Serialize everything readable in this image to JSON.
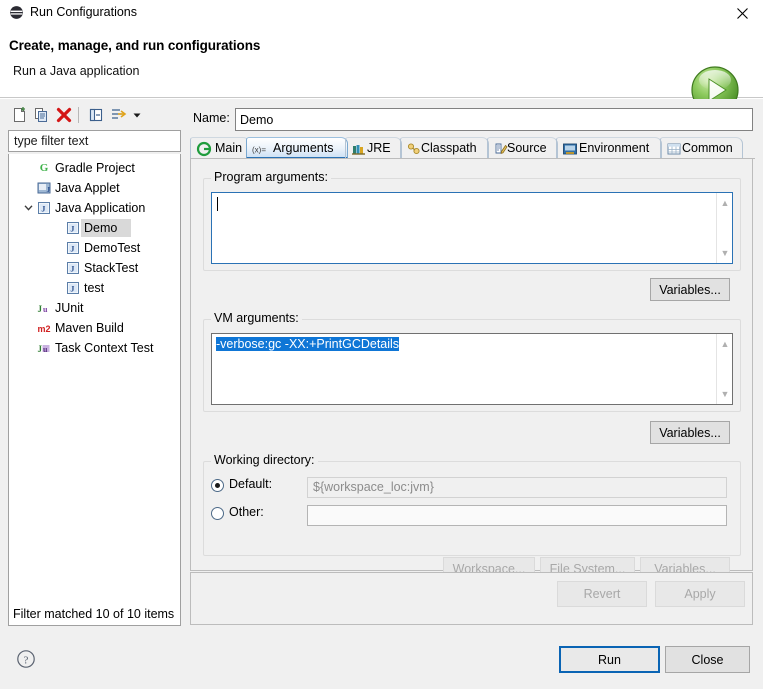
{
  "window": {
    "title": "Run Configurations",
    "icon": "eclipse-icon",
    "close_icon": "close-icon"
  },
  "header": {
    "title": "Create, manage, and run configurations",
    "subtitle": "Run a Java application",
    "badge_icon": "run-green-play-icon"
  },
  "sidebar": {
    "toolbar": [
      {
        "name": "new-configuration-button",
        "icon": "new-document-icon"
      },
      {
        "name": "duplicate-configuration-button",
        "icon": "copy-icon"
      },
      {
        "name": "delete-configuration-button",
        "icon": "red-x-delete-icon"
      },
      {
        "name": "collapse-all-button",
        "icon": "collapse-all-icon"
      },
      {
        "name": "filter-configurations-button",
        "icon": "filter-arrow-icon"
      },
      {
        "name": "view-menu-button",
        "icon": "chevron-down-icon"
      }
    ],
    "filter": {
      "placeholder": "type filter text",
      "value": "type filter text"
    },
    "tree": [
      {
        "label": "Gradle Project",
        "level": 1,
        "icon": "gradle-icon",
        "glyph": "G",
        "glyph_color": "#3fb24a",
        "selected": false,
        "twisty": ""
      },
      {
        "label": "Java Applet",
        "level": 1,
        "icon": "java-applet-icon",
        "glyph": "J",
        "glyph_color": "#2b4f8e",
        "selected": false,
        "twisty": ""
      },
      {
        "label": "Java Application",
        "level": 1,
        "icon": "java-application-icon",
        "glyph": "J",
        "glyph_color": "#2b4f8e",
        "selected": false,
        "twisty": "v"
      },
      {
        "label": "Demo",
        "level": 2,
        "icon": "java-launch-icon",
        "glyph": "J",
        "glyph_color": "#2b4f8e",
        "selected": true,
        "twisty": ""
      },
      {
        "label": "DemoTest",
        "level": 2,
        "icon": "java-launch-icon",
        "glyph": "J",
        "glyph_color": "#2b4f8e",
        "selected": false,
        "twisty": ""
      },
      {
        "label": "StackTest",
        "level": 2,
        "icon": "java-launch-icon",
        "glyph": "J",
        "glyph_color": "#2b4f8e",
        "selected": false,
        "twisty": ""
      },
      {
        "label": "test",
        "level": 2,
        "icon": "java-launch-icon",
        "glyph": "J",
        "glyph_color": "#2b4f8e",
        "selected": false,
        "twisty": ""
      },
      {
        "label": "JUnit",
        "level": 1,
        "icon": "junit-icon",
        "glyph": "Ju",
        "glyph_color": "#2f7d32",
        "selected": false,
        "twisty": ""
      },
      {
        "label": "Maven Build",
        "level": 1,
        "icon": "maven-icon",
        "glyph": "m2",
        "glyph_color": "#d02020",
        "selected": false,
        "twisty": ""
      },
      {
        "label": "Task Context Test",
        "level": 1,
        "icon": "task-context-icon",
        "glyph": "Ju",
        "glyph_color": "#2f7d32",
        "selected": false,
        "twisty": ""
      }
    ],
    "status": "Filter matched 10 of 10 items"
  },
  "main": {
    "name_label": "Name:",
    "name_value": "Demo",
    "tabs": [
      {
        "label": "Main",
        "icon": "main-green-circle-icon",
        "active": false
      },
      {
        "label": "Arguments",
        "icon": "arguments-xequals-icon",
        "active": true
      },
      {
        "label": "JRE",
        "icon": "jre-books-icon",
        "active": false
      },
      {
        "label": "Classpath",
        "icon": "classpath-icon",
        "active": false
      },
      {
        "label": "Source",
        "icon": "source-pencil-icon",
        "active": false
      },
      {
        "label": "Environment",
        "icon": "environment-icon",
        "active": false
      },
      {
        "label": "Common",
        "icon": "common-table-icon",
        "active": false
      }
    ],
    "program_arguments": {
      "label": "Program arguments:",
      "value": "",
      "variables_button": "Variables..."
    },
    "vm_arguments": {
      "label": "VM arguments:",
      "value": "-verbose:gc -XX:+PrintGCDetails",
      "selected_text": "-verbose:gc -XX:+PrintGCDetails",
      "selection_color": "#0f76d6",
      "variables_button": "Variables..."
    },
    "working_directory": {
      "label": "Working directory:",
      "default_label": "Default:",
      "default_selected": true,
      "default_value": "${workspace_loc:jvm}",
      "other_label": "Other:",
      "other_selected": false,
      "other_value": "",
      "workspace_button": "Workspace...",
      "file_system_button": "File System...",
      "variables_button": "Variables..."
    },
    "revert_button": "Revert",
    "apply_button": "Apply"
  },
  "footer": {
    "help_icon": "help-question-icon",
    "run_button": "Run",
    "close_button": "Close"
  }
}
